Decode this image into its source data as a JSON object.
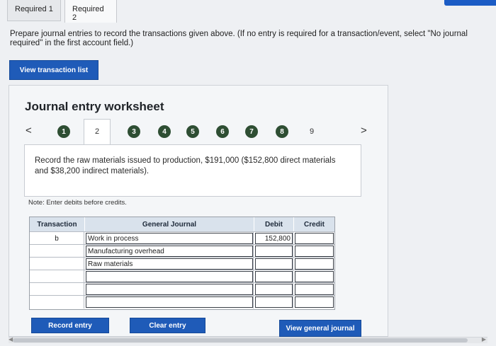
{
  "tabs": [
    {
      "label": "Required 1",
      "active": false
    },
    {
      "label": "Required 2",
      "active": true
    }
  ],
  "instructions": "Prepare journal entries to record the transactions given above. (If no entry is required for a transaction/event, select \"No journal entry required\" in the first account field.)",
  "instructions_line1": "Prepare journal entries to record the transactions given above. (If no entry is required for a transaction/event, select \"No journal",
  "instructions_line2": "required\" in the first account field.)",
  "view_transaction_list": "View transaction list",
  "worksheet": {
    "title": "Journal entry worksheet",
    "prev": "<",
    "next": ">",
    "steps": [
      "1",
      "2",
      "3",
      "4",
      "5",
      "6",
      "7",
      "8",
      "9"
    ],
    "current_step": "2",
    "description": "Record the raw materials issued to production, $191,000 ($152,800 direct materials and $38,200 indirect materials).",
    "note": "Note: Enter debits before credits."
  },
  "journal": {
    "headers": {
      "transaction": "Transaction",
      "general_journal": "General Journal",
      "debit": "Debit",
      "credit": "Credit"
    },
    "rows": [
      {
        "transaction": "b",
        "account": "Work in process",
        "debit": "152,800",
        "credit": ""
      },
      {
        "transaction": "",
        "account": "Manufacturing overhead",
        "debit": "",
        "credit": ""
      },
      {
        "transaction": "",
        "account": "Raw materials",
        "debit": "",
        "credit": ""
      },
      {
        "transaction": "",
        "account": "",
        "debit": "",
        "credit": ""
      },
      {
        "transaction": "",
        "account": "",
        "debit": "",
        "credit": ""
      },
      {
        "transaction": "",
        "account": "",
        "debit": "",
        "credit": ""
      }
    ]
  },
  "buttons": {
    "record_entry": "Record entry",
    "clear_entry": "Clear entry",
    "view_general_journal": "View general journal"
  },
  "colors": {
    "primary_button": "#1f5bb8",
    "step_complete": "#2e4e33",
    "header_fill": "#d9e2ec"
  }
}
